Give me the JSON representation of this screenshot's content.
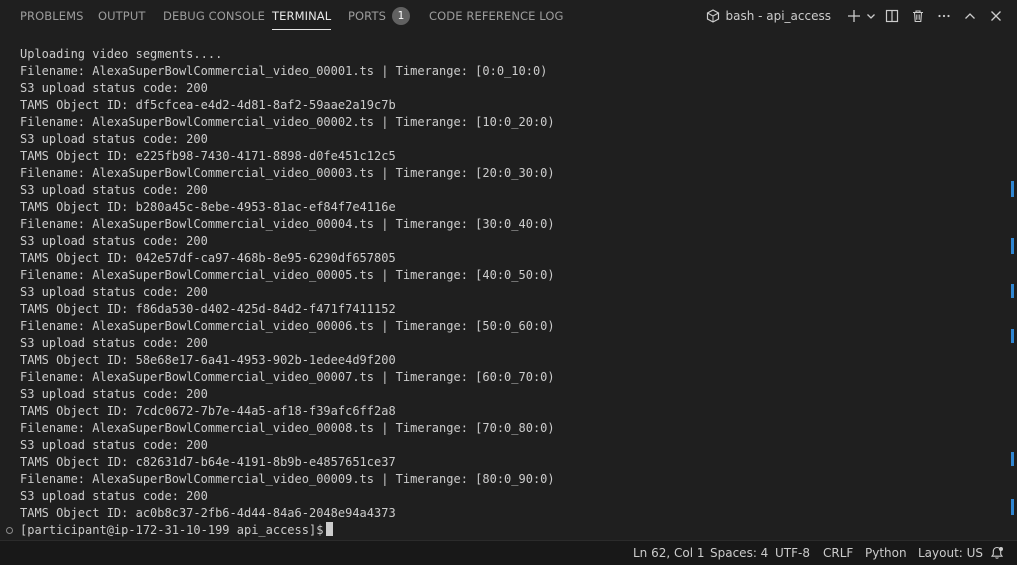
{
  "tabs": [
    {
      "label": "PROBLEMS"
    },
    {
      "label": "OUTPUT"
    },
    {
      "label": "DEBUG CONSOLE"
    },
    {
      "label": "TERMINAL",
      "active": true
    },
    {
      "label": "PORTS",
      "badge": "1"
    },
    {
      "label": "CODE REFERENCE LOG"
    }
  ],
  "toolbar": {
    "terminal_name": "bash - api_access",
    "icons": [
      "terminal-icon",
      "plus-icon",
      "chevron-down-icon",
      "split-icon",
      "trash-icon",
      "ellipsis-icon",
      "chevron-up-icon",
      "close-icon"
    ]
  },
  "terminal": {
    "lines": [
      "Uploading video segments....",
      "Filename: AlexaSuperBowlCommercial_video_00001.ts | Timerange: [0:0_10:0)",
      "S3 upload status code: 200",
      "TAMS Object ID: df5cfcea-e4d2-4d81-8af2-59aae2a19c7b",
      "Filename: AlexaSuperBowlCommercial_video_00002.ts | Timerange: [10:0_20:0)",
      "S3 upload status code: 200",
      "TAMS Object ID: e225fb98-7430-4171-8898-d0fe451c12c5",
      "Filename: AlexaSuperBowlCommercial_video_00003.ts | Timerange: [20:0_30:0)",
      "S3 upload status code: 200",
      "TAMS Object ID: b280a45c-8ebe-4953-81ac-ef84f7e4116e",
      "Filename: AlexaSuperBowlCommercial_video_00004.ts | Timerange: [30:0_40:0)",
      "S3 upload status code: 200",
      "TAMS Object ID: 042e57df-ca97-468b-8e95-6290df657805",
      "Filename: AlexaSuperBowlCommercial_video_00005.ts | Timerange: [40:0_50:0)",
      "S3 upload status code: 200",
      "TAMS Object ID: f86da530-d402-425d-84d2-f471f7411152",
      "Filename: AlexaSuperBowlCommercial_video_00006.ts | Timerange: [50:0_60:0)",
      "S3 upload status code: 200",
      "TAMS Object ID: 58e68e17-6a41-4953-902b-1edee4d9f200",
      "Filename: AlexaSuperBowlCommercial_video_00007.ts | Timerange: [60:0_70:0)",
      "S3 upload status code: 200",
      "TAMS Object ID: 7cdc0672-7b7e-44a5-af18-f39afc6ff2a8",
      "Filename: AlexaSuperBowlCommercial_video_00008.ts | Timerange: [70:0_80:0)",
      "S3 upload status code: 200",
      "TAMS Object ID: c82631d7-b64e-4191-8b9b-e4857651ce37",
      "Filename: AlexaSuperBowlCommercial_video_00009.ts | Timerange: [80:0_90:0)",
      "S3 upload status code: 200",
      "TAMS Object ID: ac0b8c37-2fb6-4d44-84a6-2048e94a4373"
    ],
    "prompt": "[participant@ip-172-31-10-199 api_access]$"
  },
  "statusbar": {
    "position": "Ln 62, Col 1",
    "spaces": "Spaces: 4",
    "encoding": "UTF-8",
    "eol": "CRLF",
    "language": "Python",
    "layout": "Layout: US"
  },
  "colors": {
    "background": "#1f1f1f",
    "statusbar": "#181818",
    "accent": "#2f86d2",
    "text": "#cccccc"
  }
}
